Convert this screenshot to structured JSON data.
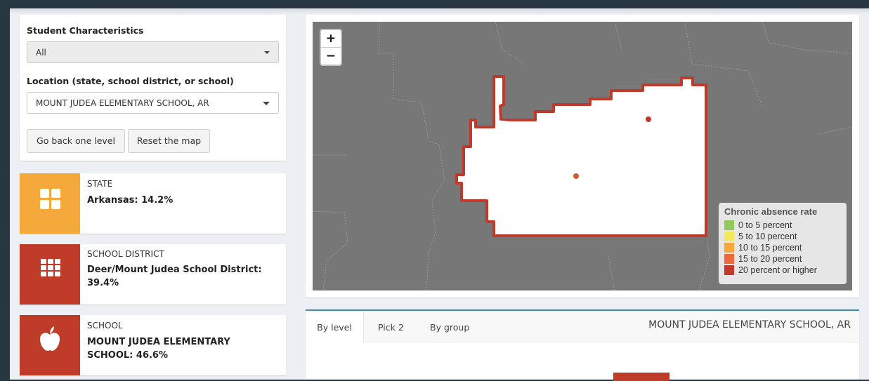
{
  "filters": {
    "student_label": "Student Characteristics",
    "student_value": "All",
    "location_label": "Location (state, school district, or school)",
    "location_value": "MOUNT JUDEA ELEMENTARY SCHOOL, AR",
    "back_button": "Go back one level",
    "reset_button": "Reset the map"
  },
  "cards": [
    {
      "caption": "STATE",
      "value": "Arkansas: 14.2%",
      "icon": "grid-2x2-icon",
      "color": "#f5a93b"
    },
    {
      "caption": "SCHOOL DISTRICT",
      "value": "Deer/Mount Judea School District: 39.4%",
      "icon": "grid-3x3-icon",
      "color": "#be3b27"
    },
    {
      "caption": "SCHOOL",
      "value": "MOUNT JUDEA ELEMENTARY SCHOOL: 46.6%",
      "icon": "apple-icon",
      "color": "#be3b27"
    }
  ],
  "map": {
    "zoom_in": "+",
    "zoom_out": "−",
    "legend": {
      "title": "Chronic absence rate",
      "items": [
        {
          "label": "0 to 5 percent",
          "color": "#93c85d"
        },
        {
          "label": "5 to 10 percent",
          "color": "#f2e85a"
        },
        {
          "label": "10 to 15 percent",
          "color": "#f5a93b"
        },
        {
          "label": "15 to 20 percent",
          "color": "#ee6a3d"
        },
        {
          "label": "20 percent or higher",
          "color": "#c0392b"
        }
      ]
    }
  },
  "tabs": {
    "items": [
      "By level",
      "Pick 2",
      "By group"
    ],
    "active": "By level",
    "title": "MOUNT JUDEA ELEMENTARY SCHOOL, AR"
  }
}
